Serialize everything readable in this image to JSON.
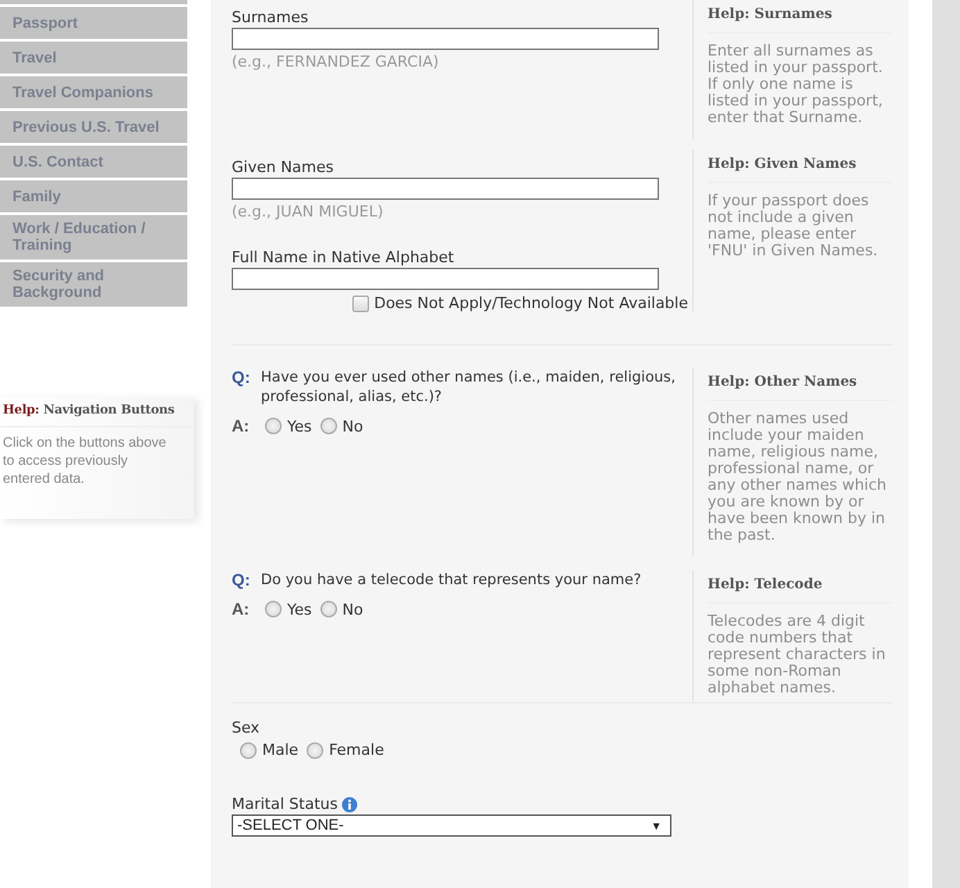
{
  "nav": [
    "Passport",
    "Travel",
    "Travel Companions",
    "Previous U.S. Travel",
    "U.S. Contact",
    "Family",
    "Work / Education / Training",
    "Security and Background"
  ],
  "nav_help": {
    "prefix": "Help:",
    "title": "Navigation Buttons",
    "text": "Click on the buttons above to access previously entered data."
  },
  "name_rows": [
    {
      "fields": [
        {
          "label": "Surnames",
          "example": "(e.g., FERNANDEZ GARCIA)"
        }
      ],
      "help": {
        "prefix": "Help:",
        "title": "Surnames",
        "text": "Enter all surnames as listed in your passport. If only one name is listed in your passport, enter that Surname."
      }
    },
    {
      "fields": [
        {
          "label": "Given Names",
          "example": "(e.g., JUAN MIGUEL)"
        },
        {
          "label": "Full Name in Native Alphabet",
          "checkbox": {
            "label": "Does Not Apply/Technology Not Available",
            "checked": false
          }
        }
      ],
      "help": {
        "prefix": "Help:",
        "title": "Given Names",
        "text": "If your passport does not include a given name, please enter 'FNU' in Given Names."
      }
    }
  ],
  "questions": [
    {
      "q": "Q:",
      "text": "Have you ever used other names (i.e., maiden, religious, professional, alias, etc.)?",
      "a": "A:",
      "options": [
        {
          "label": "Yes",
          "selected": false
        },
        {
          "label": "No",
          "selected": false
        }
      ],
      "help": {
        "prefix": "Help:",
        "title": "Other Names",
        "text": "Other names used include your maiden name, religious name, professional name, or any other names which you are known by or have been known by in the past."
      }
    },
    {
      "q": "Q:",
      "text": "Do you have a telecode that represents your name?",
      "a": "A:",
      "options": [
        {
          "label": "Yes",
          "selected": false
        },
        {
          "label": "No",
          "selected": false
        }
      ],
      "help": {
        "prefix": "Help:",
        "title": "Telecode",
        "text": "Telecodes are 4 digit code numbers that represent characters in some non-Roman alphabet names."
      }
    }
  ],
  "sex": {
    "label": "Sex",
    "options": [
      {
        "label": "Male",
        "selected": false
      },
      {
        "label": "Female",
        "selected": false
      }
    ]
  },
  "marital_status": {
    "label": "Marital Status",
    "value": "-SELECT ONE-",
    "arrow": "▼"
  }
}
